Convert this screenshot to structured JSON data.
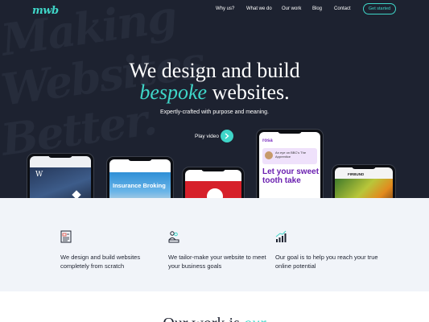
{
  "header": {
    "logo": "mwb",
    "nav": [
      "Why us?",
      "What we do",
      "Our work",
      "Blog",
      "Contact"
    ],
    "cta": "Get started"
  },
  "hero": {
    "bg_words": [
      "Making",
      "Websites",
      "Better."
    ],
    "headline_line1": "We design and build",
    "headline_accent": "bespoke",
    "headline_rest": " websites.",
    "subtitle": "Expertly-crafted with purpose and meaning.",
    "play_label": "Play video"
  },
  "phones": {
    "p2_banner": "Insurance Broking",
    "p4_brand": "rosa",
    "p4_card": "An eye on BBC's The Apprentice",
    "p4_headline": "Let your sweet tooth take",
    "p5_tag": "FIRBUND"
  },
  "features": [
    {
      "icon": "document-icon",
      "text": "We design and build websites completely from scratch"
    },
    {
      "icon": "people-icon",
      "text": "We tailor-make your website to meet your business goals"
    },
    {
      "icon": "growth-chart-icon",
      "text": "Our goal is to help you reach your true online potential"
    }
  ],
  "section": {
    "heading": "Our work is",
    "heading_accent": "our"
  },
  "colors": {
    "accent": "#3fd6c8",
    "dark_bg": "#1d2230",
    "light_bg": "#f1f4f9"
  }
}
